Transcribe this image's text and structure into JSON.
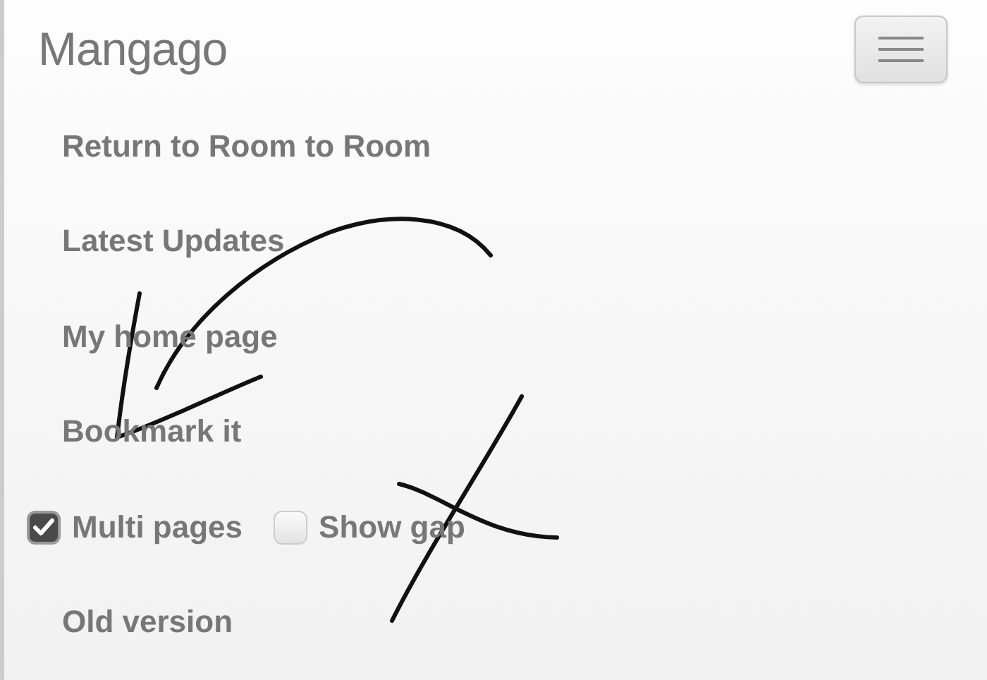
{
  "brand": "Mangago",
  "menu_items": [
    {
      "label": "Return to Room to Room"
    },
    {
      "label": "Latest Updates"
    },
    {
      "label": "My home page"
    },
    {
      "label": "Bookmark it"
    }
  ],
  "options": [
    {
      "label": "Multi pages",
      "checked": true
    },
    {
      "label": "Show gap",
      "checked": false
    }
  ],
  "footer_link": "Old version"
}
